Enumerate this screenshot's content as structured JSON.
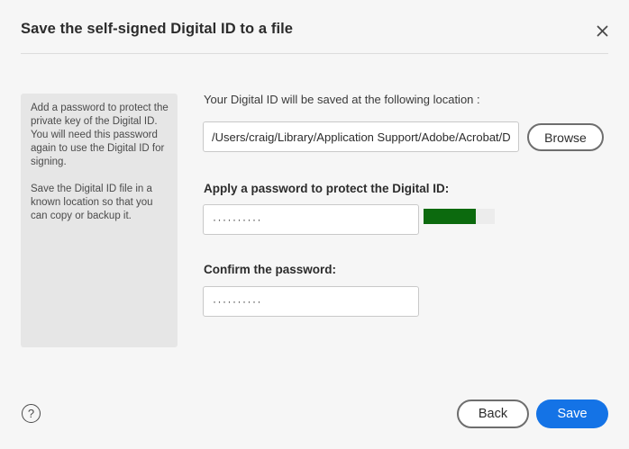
{
  "dialog": {
    "title": "Save the self-signed Digital ID to a file",
    "close_icon": "close-icon"
  },
  "info_panel": {
    "paragraph1": "Add a password to protect the private key of the Digital ID. You will need this password again to use the Digital ID for signing.",
    "paragraph2": "Save the Digital ID file in a known location so that you can copy or backup it."
  },
  "location": {
    "label": "Your Digital ID will be saved at the following location :",
    "value": "/Users/craig/Library/Application Support/Adobe/Acrobat/DC/Security/SelfSigned.pfx",
    "browse_label": "Browse"
  },
  "password": {
    "label": "Apply a password to protect the Digital ID:",
    "masked_value": "··········",
    "strength_fraction": 0.74,
    "strength_color": "#0c6a0e"
  },
  "confirm": {
    "label": "Confirm the password:",
    "masked_value": "··········"
  },
  "footer": {
    "help_glyph": "?",
    "back_label": "Back",
    "save_label": "Save"
  },
  "colors": {
    "accent": "#1473e6",
    "panel_background": "#e6e6e6",
    "dialog_background": "#f6f6f6"
  }
}
